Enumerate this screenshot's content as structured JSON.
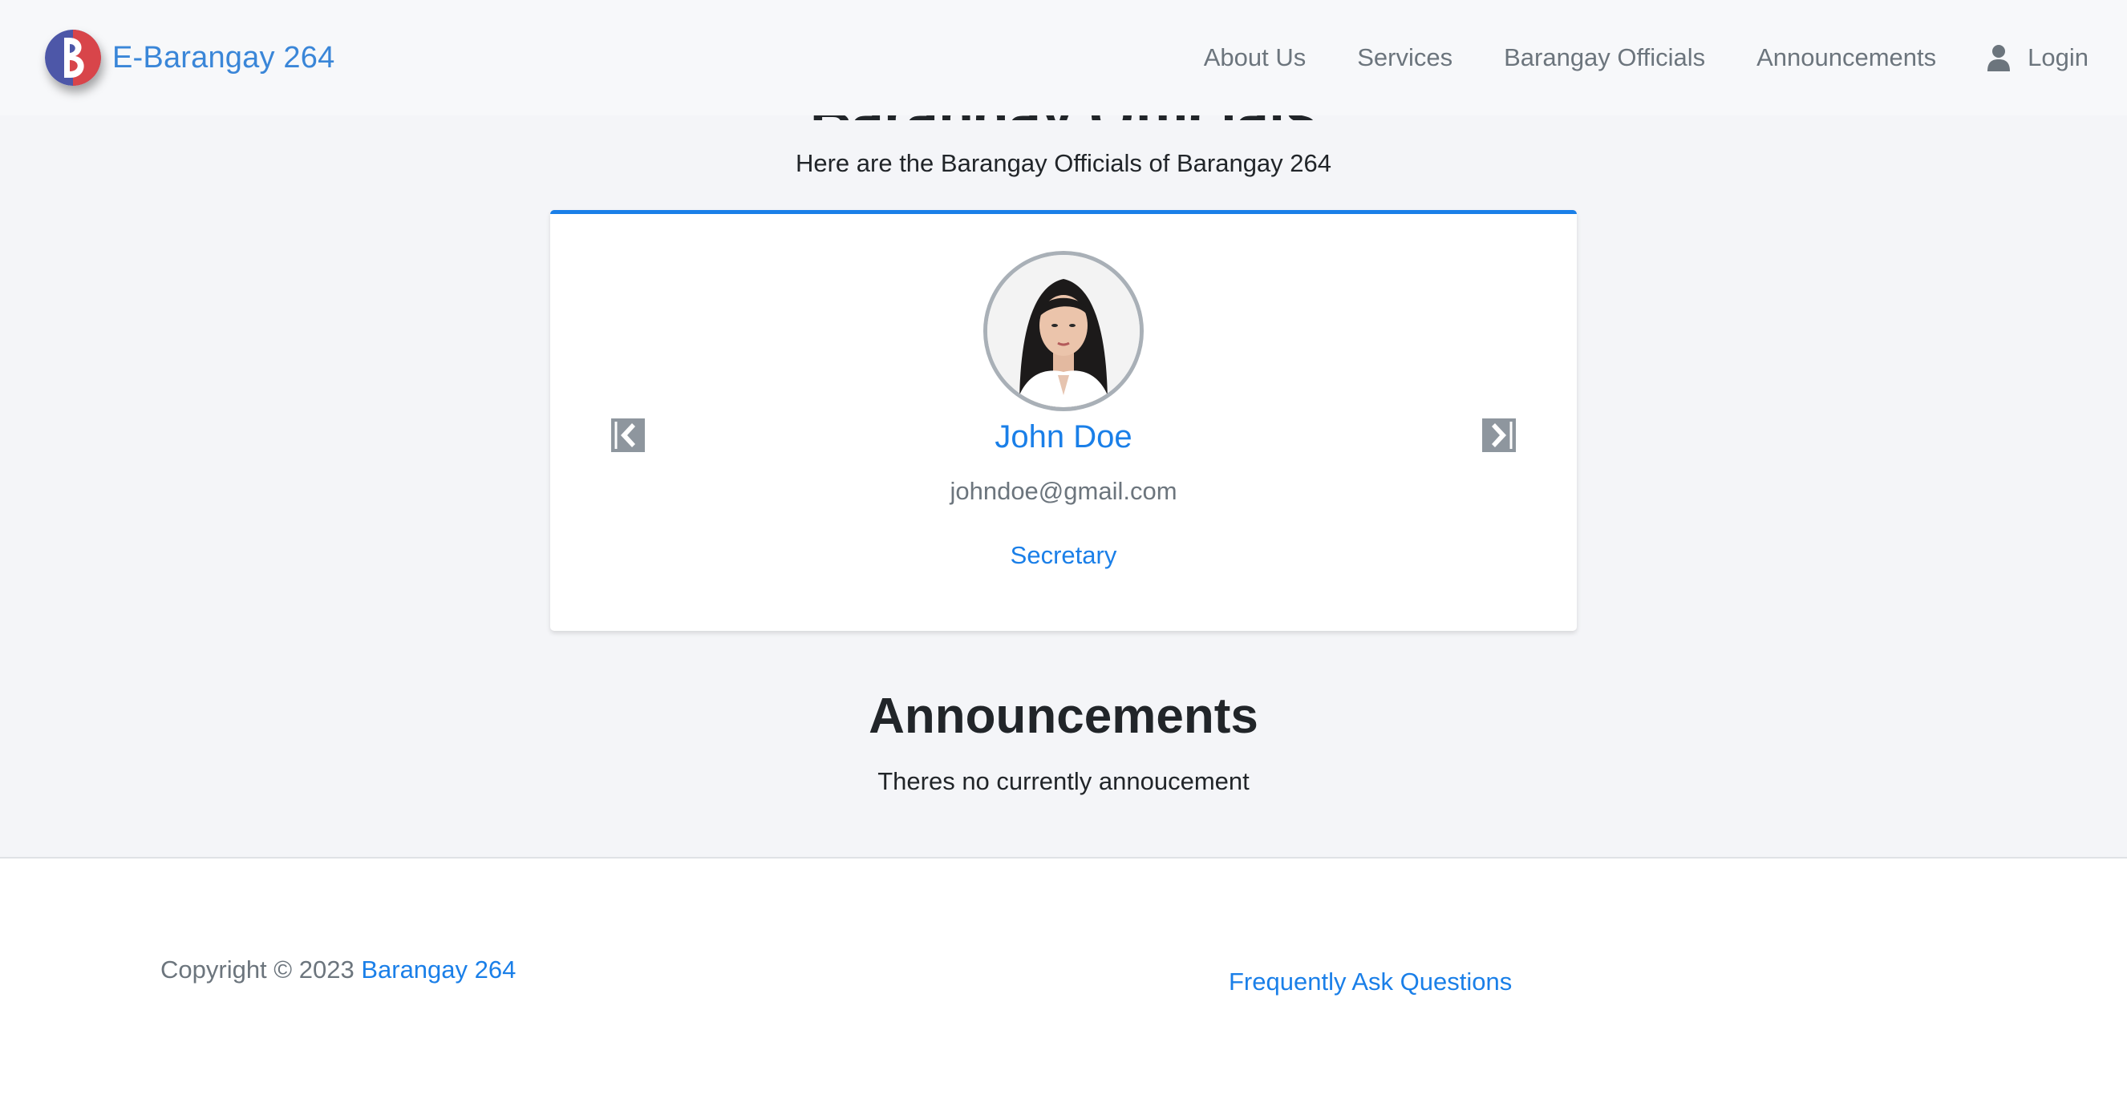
{
  "navbar": {
    "brand": "E-Barangay 264",
    "links": [
      "About Us",
      "Services",
      "Barangay Officials",
      "Announcements"
    ],
    "login": "Login"
  },
  "officials": {
    "heading": "Barangay Officials",
    "subtitle": "Here are the Barangay Officials of Barangay 264",
    "current": {
      "name": "John Doe",
      "email": "johndoe@gmail.com",
      "position": "Secretary"
    }
  },
  "announcements": {
    "title": "Announcements",
    "empty_message": "Theres no currently annoucement"
  },
  "footer": {
    "copyright_prefix": "Copyright © 2023",
    "copyright_link": "Barangay 264",
    "faq": "Frequently Ask Questions"
  },
  "colors": {
    "accent": "#1a7fe8",
    "muted": "#6c757d",
    "background": "#f4f5f8"
  }
}
